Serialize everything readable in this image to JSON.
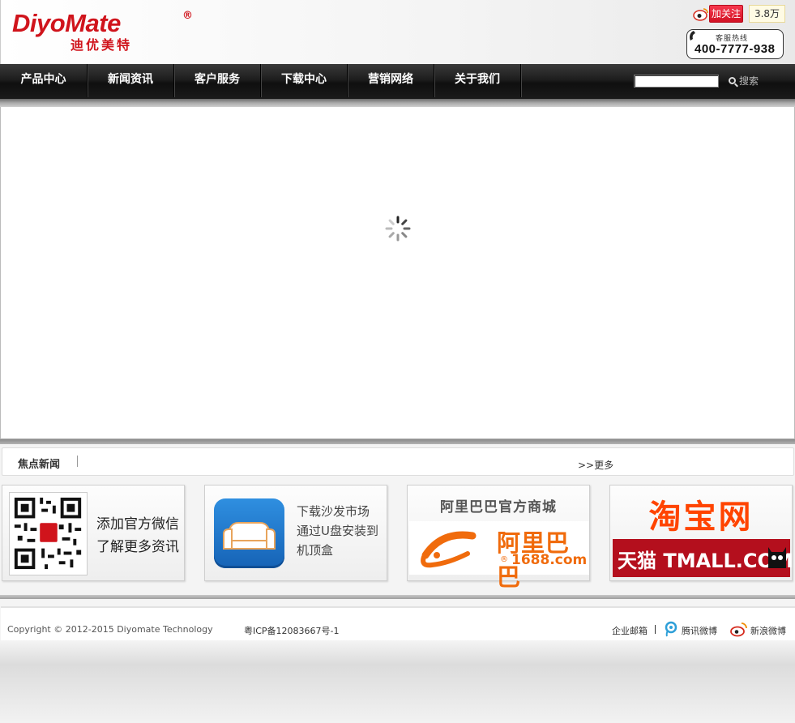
{
  "header": {
    "logo_en": "DiyoMate",
    "logo_reg": "®",
    "logo_cn": "迪优美特",
    "hotline_label": "客服热线",
    "hotline_number": "400-7777-938"
  },
  "nav": {
    "items": [
      {
        "label": "产品中心"
      },
      {
        "label": "新闻资讯"
      },
      {
        "label": "客户服务"
      },
      {
        "label": "下载中心"
      },
      {
        "label": "营销网络"
      },
      {
        "label": "关于我们"
      }
    ],
    "search_value": "",
    "search_button": "搜索"
  },
  "news": {
    "title": "焦点新闻",
    "more": ">>更多",
    "follow_label": "加关注",
    "follower_count": "3.8万"
  },
  "promos": {
    "wechat_line1": "添加官方微信",
    "wechat_line2": "了解更多资讯",
    "sofa_line1": "下载沙发市场",
    "sofa_line2": "通过U盘安装到",
    "sofa_line3": "机顶盒",
    "alibaba_title": "阿里巴巴官方商城",
    "alibaba_cn": "阿里巴巴",
    "alibaba_domain": "1688.com",
    "alibaba_reg": "®",
    "taobao_title": "淘宝网",
    "tmall_text": "天猫 TMALL.COM"
  },
  "footer": {
    "copyright": "Copyright © 2012-2015 Diyomate Technology",
    "icp": "粤ICP备12083667号-1",
    "enterprise_mail": "企业邮箱",
    "tencent_weibo": "腾讯微博",
    "sina_weibo": "新浪微博"
  },
  "colors": {
    "brand_red": "#d0141c",
    "nav_bg": "#1d1d1d",
    "taobao_orange": "#ff4400",
    "alibaba_orange": "#f06b0c",
    "tmall_red": "#b40f1d"
  }
}
